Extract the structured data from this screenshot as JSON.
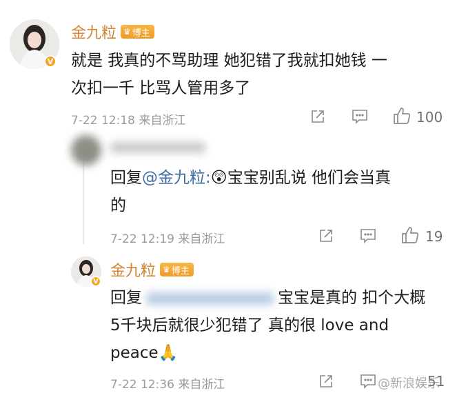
{
  "comment1": {
    "author": "金九粒",
    "badge": "博主",
    "text_line1": "就是 我真的不骂助理 她犯错了我就扣她钱 一",
    "text_line2": "次扣一千 比骂人管用多了",
    "meta": "7-22 12:18 来自浙江",
    "likes": "100"
  },
  "reply1": {
    "reply_prefix": "回复",
    "mention": "@金九粒:",
    "emoji": "😲",
    "text_line1": "宝宝别乱说 他们会当真",
    "text_line2": "的",
    "meta": "7-22 12:19 来自浙江",
    "likes": "19"
  },
  "reply2": {
    "author": "金九粒",
    "badge": "博主",
    "reply_prefix": "回复",
    "text_line1_rest": "宝宝是真的 扣个大概",
    "text_line2": "5千块后就很少犯错了 真的很 love and",
    "text_line3": "peace",
    "emoji": "🙏",
    "meta": "7-22 12:36 来自浙江",
    "likes": "51"
  },
  "watermark": "@新浪娱乐",
  "colors": {
    "name": "#d48431",
    "mention": "#3f6ea8",
    "badge": "#f2a33a",
    "meta": "#9a9a9a"
  }
}
